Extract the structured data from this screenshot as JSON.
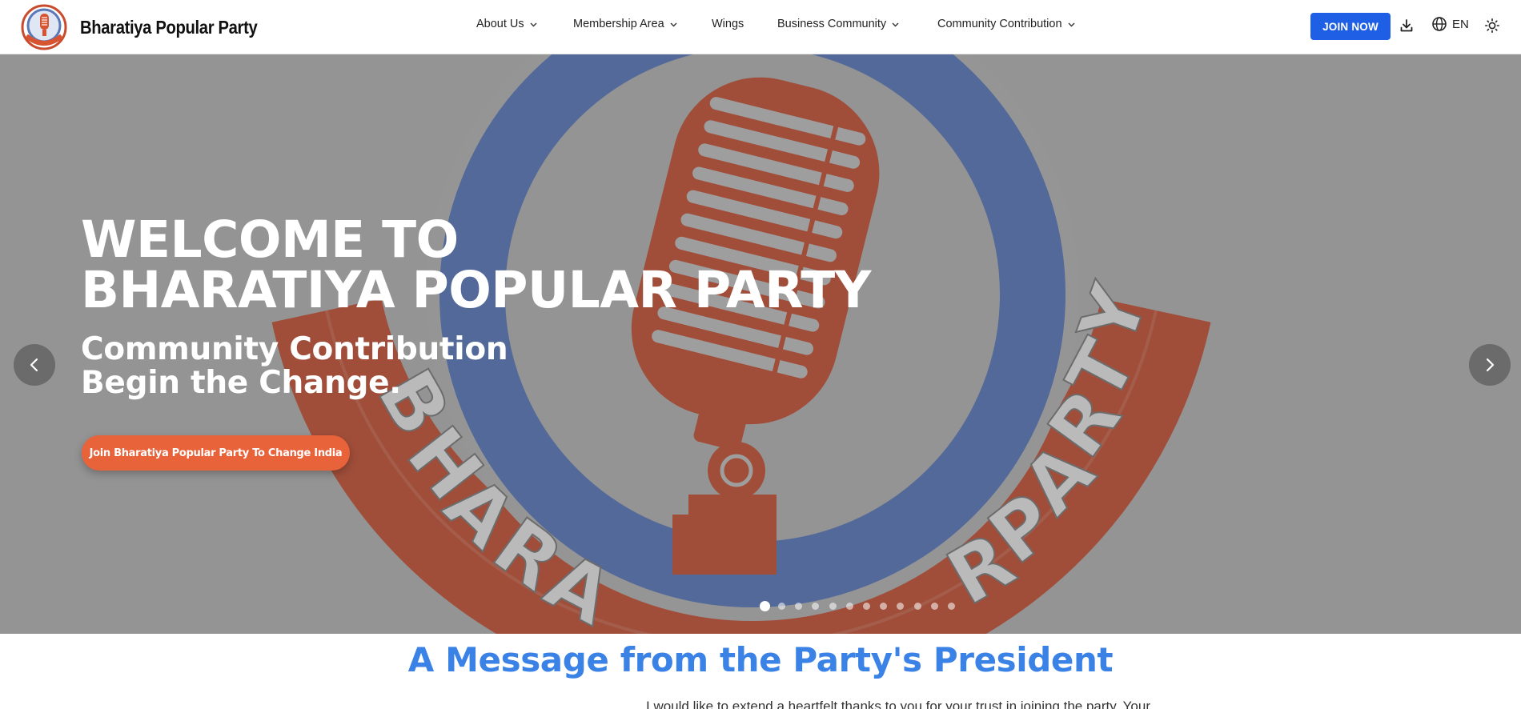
{
  "header": {
    "brand_name": "Bharatiya Popular Party",
    "logo_icon": "party-logo-microphone",
    "nav": [
      {
        "label": "About Us",
        "has_dropdown": true
      },
      {
        "label": "Membership Area",
        "has_dropdown": true
      },
      {
        "label": "Wings",
        "has_dropdown": false
      },
      {
        "label": "Business Community",
        "has_dropdown": true
      },
      {
        "label": "Community Contribution",
        "has_dropdown": true
      }
    ],
    "join_label": "JOIN NOW",
    "download_icon": "download-icon",
    "language_icon": "globe-icon",
    "language": "EN",
    "theme_icon": "sun-icon"
  },
  "hero": {
    "title_line1": "WELCOME TO",
    "title_line2": "BHARATIYA POPULAR PARTY",
    "subtitle_line1": "Community Contribution",
    "subtitle_line2": "Begin the Change.",
    "cta_label": "Join Bharatiya Popular Party To Change India",
    "background_image": "party-logo-microphone",
    "slide_count": 12,
    "active_slide": 1
  },
  "message": {
    "title": "A Message from the Party's President",
    "text_preview": "I would like to extend a heartfelt thanks to you for your trust in joining the party. Your"
  },
  "colors": {
    "brand_blue": "#1f5fe6",
    "cta_orange": "#e8623a",
    "heading_blue": "#3b82e6",
    "logo_red": "#b0452d",
    "logo_ring_blue": "#4a66a0"
  }
}
